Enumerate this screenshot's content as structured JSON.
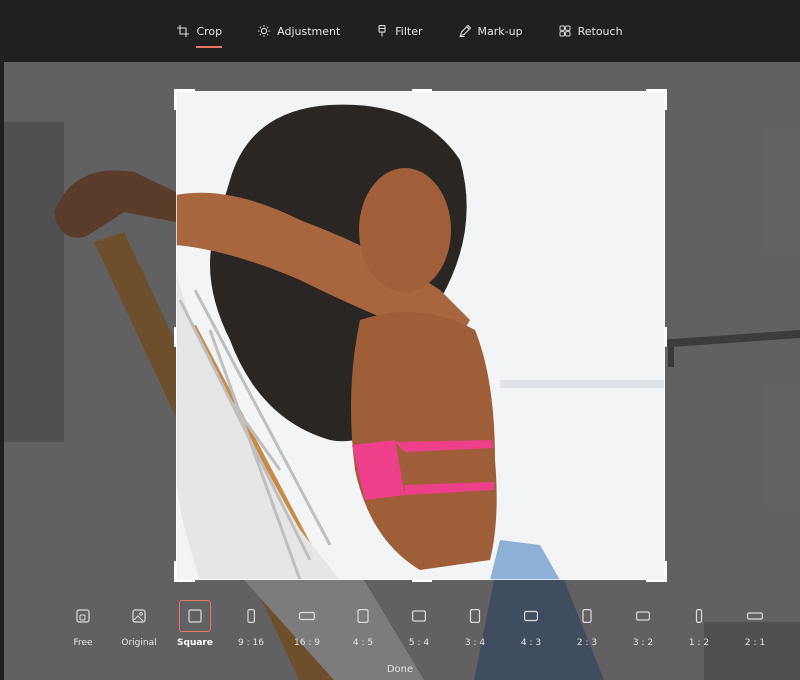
{
  "accent_color": "#e97660",
  "toolbar": {
    "tabs": [
      {
        "label": "Crop",
        "icon": "crop-icon",
        "active": true
      },
      {
        "label": "Adjustment",
        "icon": "brightness-icon",
        "active": false
      },
      {
        "label": "Filter",
        "icon": "filter-icon",
        "active": false
      },
      {
        "label": "Mark-up",
        "icon": "pen-icon",
        "active": false
      },
      {
        "label": "Retouch",
        "icon": "retouch-icon",
        "active": false
      }
    ]
  },
  "aspect_ratios": [
    {
      "label": "Free",
      "icon": "free-crop-icon",
      "selected": false
    },
    {
      "label": "Original",
      "icon": "image-icon",
      "selected": false
    },
    {
      "label": "Square",
      "icon": "square-icon",
      "selected": true
    },
    {
      "label": "9 : 16",
      "icon": "portrait-9-16-icon",
      "selected": false
    },
    {
      "label": "16 : 9",
      "icon": "landscape-16-9-icon",
      "selected": false
    },
    {
      "label": "4 : 5",
      "icon": "portrait-4-5-icon",
      "selected": false
    },
    {
      "label": "5 : 4",
      "icon": "landscape-5-4-icon",
      "selected": false
    },
    {
      "label": "3 : 4",
      "icon": "portrait-3-4-icon",
      "selected": false
    },
    {
      "label": "4 : 3",
      "icon": "landscape-4-3-icon",
      "selected": false
    },
    {
      "label": "2 : 3",
      "icon": "portrait-2-3-icon",
      "selected": false
    },
    {
      "label": "3 : 2",
      "icon": "landscape-3-2-icon",
      "selected": false
    },
    {
      "label": "1 : 2",
      "icon": "portrait-1-2-icon",
      "selected": false
    },
    {
      "label": "2 : 1",
      "icon": "landscape-2-1-icon",
      "selected": false
    }
  ],
  "done_label": "Done"
}
